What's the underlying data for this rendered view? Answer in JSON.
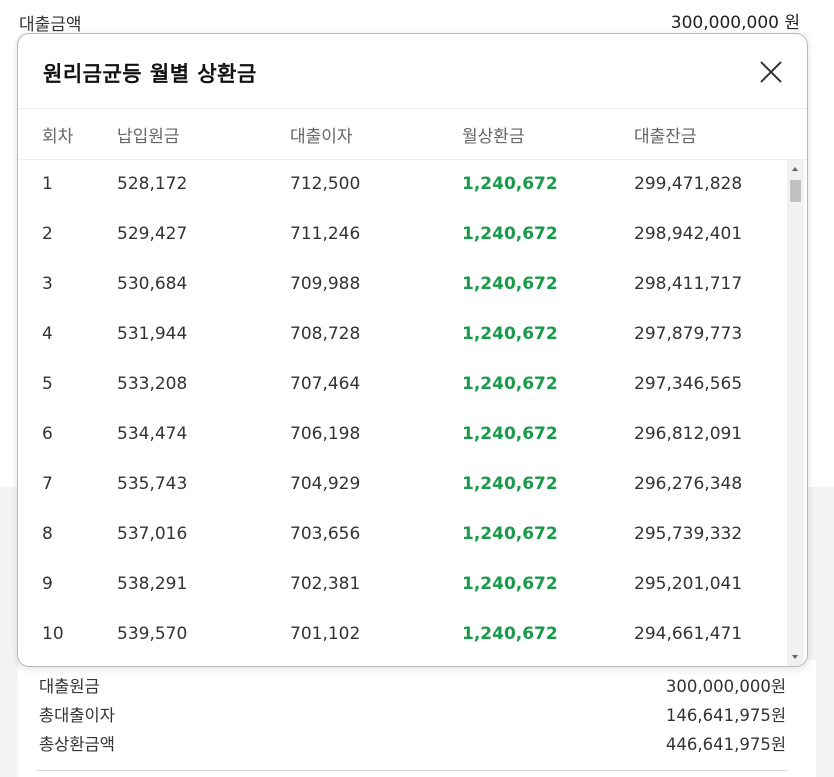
{
  "background": {
    "loan_amount_label": "대출금액",
    "loan_amount_value": "300,000,000  원",
    "summary": [
      {
        "label": "대출원금",
        "value": "300,000,000원"
      },
      {
        "label": "총대출이자",
        "value": "146,641,975원"
      },
      {
        "label": "총상환금액",
        "value": "446,641,975원"
      }
    ]
  },
  "modal": {
    "title": "원리금균등 월별 상환금",
    "close_icon": "close-icon",
    "columns": [
      "회차",
      "납입원금",
      "대출이자",
      "월상환금",
      "대출잔금"
    ],
    "rows": [
      [
        "1",
        "528,172",
        "712,500",
        "1,240,672",
        "299,471,828"
      ],
      [
        "2",
        "529,427",
        "711,246",
        "1,240,672",
        "298,942,401"
      ],
      [
        "3",
        "530,684",
        "709,988",
        "1,240,672",
        "298,411,717"
      ],
      [
        "4",
        "531,944",
        "708,728",
        "1,240,672",
        "297,879,773"
      ],
      [
        "5",
        "533,208",
        "707,464",
        "1,240,672",
        "297,346,565"
      ],
      [
        "6",
        "534,474",
        "706,198",
        "1,240,672",
        "296,812,091"
      ],
      [
        "7",
        "535,743",
        "704,929",
        "1,240,672",
        "296,276,348"
      ],
      [
        "8",
        "537,016",
        "703,656",
        "1,240,672",
        "295,739,332"
      ],
      [
        "9",
        "538,291",
        "702,381",
        "1,240,672",
        "295,201,041"
      ],
      [
        "10",
        "539,570",
        "701,102",
        "1,240,672",
        "294,661,471"
      ]
    ],
    "accent_color": "#1a9a4a"
  }
}
